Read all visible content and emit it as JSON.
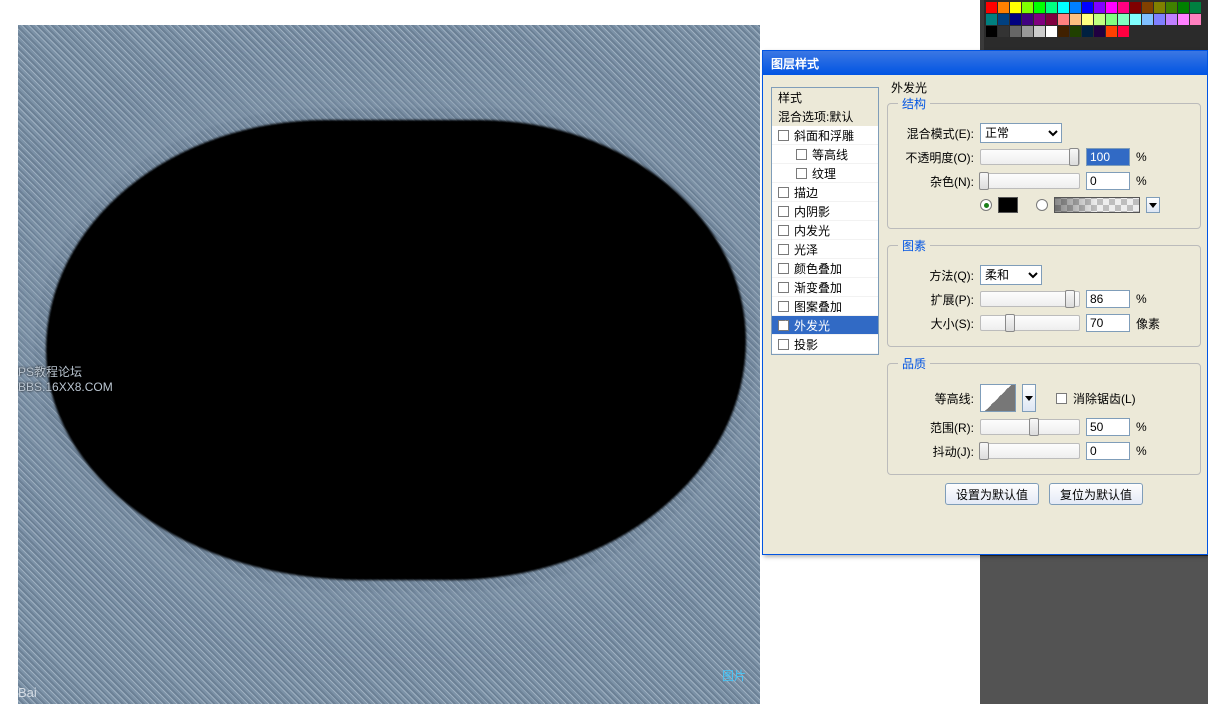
{
  "watermark": {
    "line1": "PS教程论坛",
    "line2": "BBS.16XX8.COM",
    "bottom_left": "Bai",
    "bottom_right": "图片"
  },
  "dialog": {
    "title": "图层样式",
    "sidebar": {
      "header1": "样式",
      "header2": "混合选项:默认",
      "items": [
        {
          "label": "斜面和浮雕",
          "checked": false,
          "indent": false
        },
        {
          "label": "等高线",
          "checked": false,
          "indent": true
        },
        {
          "label": "纹理",
          "checked": false,
          "indent": true
        },
        {
          "label": "描边",
          "checked": false,
          "indent": false
        },
        {
          "label": "内阴影",
          "checked": false,
          "indent": false
        },
        {
          "label": "内发光",
          "checked": false,
          "indent": false
        },
        {
          "label": "光泽",
          "checked": false,
          "indent": false
        },
        {
          "label": "颜色叠加",
          "checked": false,
          "indent": false
        },
        {
          "label": "渐变叠加",
          "checked": false,
          "indent": false
        },
        {
          "label": "图案叠加",
          "checked": false,
          "indent": false
        },
        {
          "label": "外发光",
          "checked": true,
          "indent": false,
          "selected": true
        },
        {
          "label": "投影",
          "checked": false,
          "indent": false
        }
      ]
    },
    "panel_title": "外发光",
    "structure": {
      "legend": "结构",
      "blend_mode_label": "混合模式(E):",
      "blend_mode_value": "正常",
      "opacity_label": "不透明度(O):",
      "opacity_value": "100",
      "opacity_unit": "%",
      "noise_label": "杂色(N):",
      "noise_value": "0",
      "noise_unit": "%",
      "color_swatch": "#000000"
    },
    "elements": {
      "legend": "图素",
      "technique_label": "方法(Q):",
      "technique_value": "柔和",
      "spread_label": "扩展(P):",
      "spread_value": "86",
      "spread_unit": "%",
      "size_label": "大小(S):",
      "size_value": "70",
      "size_unit": "像素"
    },
    "quality": {
      "legend": "品质",
      "contour_label": "等高线:",
      "antialias_label": "消除锯齿(L)",
      "range_label": "范围(R):",
      "range_value": "50",
      "range_unit": "%",
      "jitter_label": "抖动(J):",
      "jitter_value": "0",
      "jitter_unit": "%"
    },
    "buttons": {
      "default": "设置为默认值",
      "reset": "复位为默认值"
    }
  },
  "swatch_colors": [
    "#ff0000",
    "#ff8000",
    "#ffff00",
    "#80ff00",
    "#00ff00",
    "#00ff80",
    "#00ffff",
    "#0080ff",
    "#0000ff",
    "#8000ff",
    "#ff00ff",
    "#ff0080",
    "#800000",
    "#804000",
    "#808000",
    "#408000",
    "#008000",
    "#008040",
    "#008080",
    "#004080",
    "#000080",
    "#400080",
    "#800080",
    "#800040",
    "#ff8080",
    "#ffc080",
    "#ffff80",
    "#c0ff80",
    "#80ff80",
    "#80ffc0",
    "#80ffff",
    "#80c0ff",
    "#8080ff",
    "#c080ff",
    "#ff80ff",
    "#ff80c0",
    "#000000",
    "#333333",
    "#666666",
    "#999999",
    "#cccccc",
    "#ffffff",
    "#402000",
    "#204000",
    "#002040",
    "#200040",
    "#ff4000",
    "#ff0040"
  ]
}
